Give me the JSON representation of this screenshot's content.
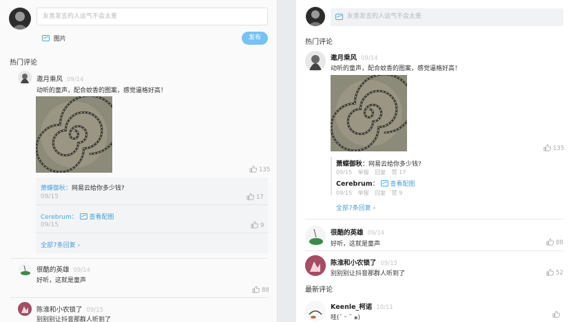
{
  "left": {
    "composer": {
      "placeholder": "友善发言的人运气不会太差",
      "image_label": "图片",
      "publish_label": "发布"
    },
    "hot_title": "热门评论",
    "comment1": {
      "user": "邀月乘风",
      "date": "09/14",
      "text": "动听的童声，配合蚊香的图案，感觉逼格好高！",
      "likes": "135"
    },
    "replies": [
      {
        "user": "萧蝶御秋：",
        "text": "网易云给你多少钱?",
        "date": "09/15",
        "likes": "17"
      },
      {
        "user": "Cerebrum：",
        "link": "查看配图",
        "date": "09/15",
        "likes": "9"
      }
    ],
    "more_replies": "全部7条回复",
    "comment2": {
      "user": "很酷的英雄",
      "date": "09/14",
      "text": "好听，这就是童声",
      "likes": "88"
    },
    "comment3": {
      "user": "陈淮和小农锁了",
      "date": "09/15",
      "text": "别别别让抖音那群人听到了"
    }
  },
  "right": {
    "composer": {
      "placeholder": "友善发言的人运气不会太差"
    },
    "hot_title": "热门评论",
    "comment1": {
      "user": "邀月乘风",
      "date": "09/14",
      "text": "动听的童声，配合蚊香的图案，感觉逼格好高！",
      "likes": "135"
    },
    "replies": [
      {
        "user": "萧蝶御秋",
        "text": "：网易云给你多少钱?",
        "date": "09/15",
        "report": "举报",
        "reply": "回复",
        "likes": "赞 17"
      },
      {
        "user": "Cerebrum",
        "link": "：",
        "link2": "查看配图",
        "date": "09/15",
        "report": "举报",
        "reply": "回复",
        "likes": "赞 9"
      }
    ],
    "more_replies": "全部7条回复",
    "comment2": {
      "user": "很酷的英雄",
      "date": "09/14",
      "text": "好听，这就是童声",
      "likes": "88"
    },
    "comment3": {
      "user": "陈淮和小农锁了",
      "date": "09/15",
      "text": "别别别让抖音那群人听到了",
      "likes": "52"
    },
    "latest_title": "最新评论",
    "comment4": {
      "user": "Keenle_柯诺",
      "date": "10/11",
      "text": "哇(˘ ᵕ ˘ ๑)"
    }
  },
  "colors": {
    "accent": "#4a9fdc",
    "publish_bg": "#75c2f3"
  }
}
